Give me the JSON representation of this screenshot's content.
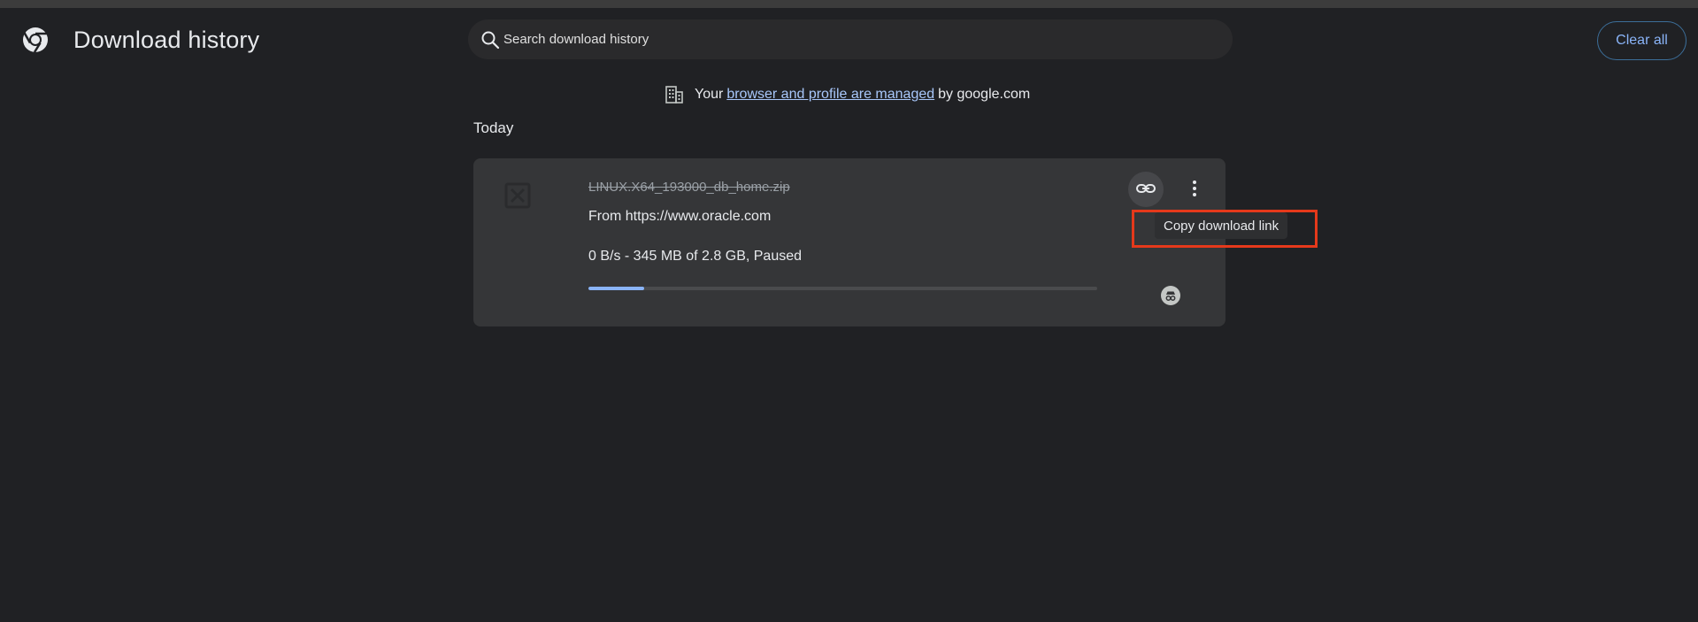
{
  "header": {
    "title": "Download history",
    "logo_icon": "chrome-logo-icon",
    "search": {
      "placeholder": "Search download history",
      "value": ""
    },
    "clear_all_label": "Clear all"
  },
  "managed_notice": {
    "prefix": "Your",
    "link_text": "browser and profile are managed",
    "suffix": "by google.com",
    "icon": "building-icon"
  },
  "sections": [
    {
      "label": "Today",
      "items": [
        {
          "file_name": "LINUX.X64_193000_db_home.zip",
          "source": "From https://www.oracle.com",
          "status": "0 B/s - 345 MB of 2.8 GB, Paused",
          "progress_fraction": 0.11,
          "actions": {
            "copy_link_icon": "link-icon",
            "more_icon": "more-vert-icon"
          },
          "tooltip": "Copy download link"
        }
      ]
    }
  ],
  "colors": {
    "background": "#202124",
    "card": "#353638",
    "accent": "#8ab4f8",
    "highlight": "#e5391b"
  }
}
